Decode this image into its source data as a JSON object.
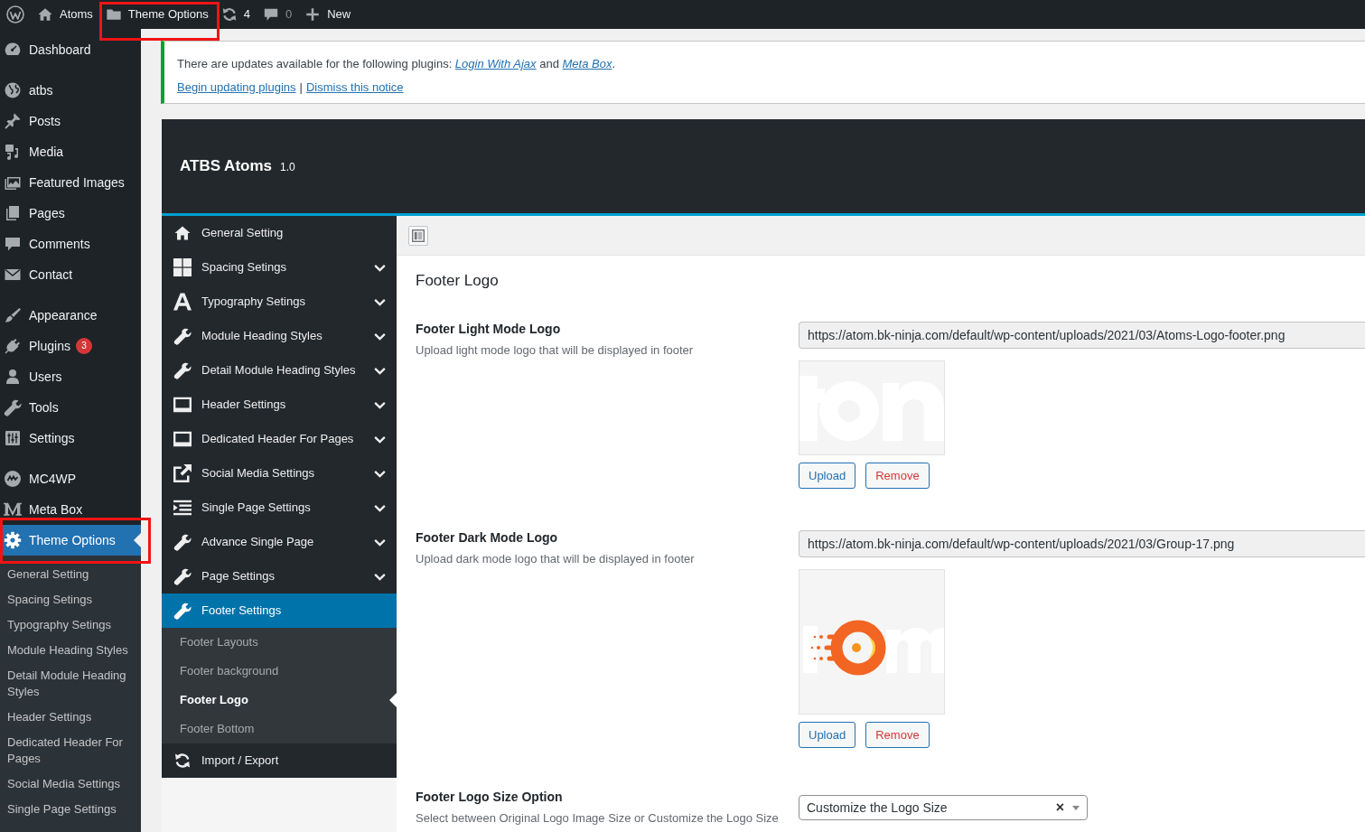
{
  "admin_bar": {
    "items": [
      {
        "label": "Atoms",
        "dimmed": false,
        "highlighted": false
      },
      {
        "label": "Theme Options",
        "dimmed": false,
        "highlighted": true
      },
      {
        "label": "4",
        "dimmed": false,
        "highlighted": false
      },
      {
        "label": "0",
        "dimmed": true,
        "highlighted": false
      },
      {
        "label": "New",
        "dimmed": false,
        "highlighted": false
      }
    ]
  },
  "sidebar": {
    "groups": [
      {
        "items": [
          {
            "label": "Dashboard",
            "selected": false,
            "highlighted": false
          }
        ]
      },
      {
        "items": [
          {
            "label": "atbs",
            "selected": false,
            "highlighted": false
          },
          {
            "label": "Posts",
            "selected": false,
            "highlighted": false
          },
          {
            "label": "Media",
            "selected": false,
            "highlighted": false
          },
          {
            "label": "Featured Images",
            "selected": false,
            "highlighted": false
          },
          {
            "label": "Pages",
            "selected": false,
            "highlighted": false
          },
          {
            "label": "Comments",
            "selected": false,
            "highlighted": false
          },
          {
            "label": "Contact",
            "selected": false,
            "highlighted": false
          }
        ]
      },
      {
        "items": [
          {
            "label": "Appearance",
            "selected": false,
            "highlighted": false
          },
          {
            "label": "Plugins",
            "badge": "3",
            "selected": false,
            "highlighted": false
          },
          {
            "label": "Users",
            "selected": false,
            "highlighted": false
          },
          {
            "label": "Tools",
            "selected": false,
            "highlighted": false
          },
          {
            "label": "Settings",
            "selected": false,
            "highlighted": false
          }
        ]
      },
      {
        "items": [
          {
            "label": "MC4WP",
            "selected": false,
            "highlighted": false
          },
          {
            "label": "Meta Box",
            "selected": false,
            "highlighted": false
          },
          {
            "label": "Theme Options",
            "selected": true,
            "highlighted": true,
            "children": [
              {
                "label": "General Setting",
                "selected": false
              },
              {
                "label": "Spacing Setings",
                "selected": false
              },
              {
                "label": "Typography Setings",
                "selected": false
              },
              {
                "label": "Module Heading Styles",
                "selected": false
              },
              {
                "label": "Detail Module Heading Styles",
                "selected": false
              },
              {
                "label": "Header Settings",
                "selected": false
              },
              {
                "label": "Dedicated Header For Pages",
                "selected": false
              },
              {
                "label": "Social Media Settings",
                "selected": false
              },
              {
                "label": "Single Page Settings",
                "selected": false
              }
            ]
          }
        ]
      }
    ]
  },
  "notice": {
    "message": [
      {
        "kind": "text",
        "text": "There are updates available for the following plugins: "
      },
      {
        "kind": "link",
        "text": "Login With Ajax"
      },
      {
        "kind": "text",
        "text": " and "
      },
      {
        "kind": "link",
        "text": "Meta Box"
      },
      {
        "kind": "text",
        "text": "."
      }
    ],
    "actions": [
      "Begin updating plugins",
      "Dismiss this notice"
    ],
    "separator": "|"
  },
  "panel": {
    "title": "ATBS Atoms",
    "version": "1.0",
    "menu": [
      {
        "label": "General Setting",
        "expandable": false,
        "selected": false
      },
      {
        "label": "Spacing Setings",
        "expandable": true,
        "selected": false
      },
      {
        "label": "Typography Setings",
        "expandable": true,
        "selected": false
      },
      {
        "label": "Module Heading Styles",
        "expandable": true,
        "selected": false
      },
      {
        "label": "Detail Module Heading Styles",
        "expandable": true,
        "selected": false
      },
      {
        "label": "Header Settings",
        "expandable": true,
        "selected": false
      },
      {
        "label": "Dedicated Header For Pages",
        "expandable": true,
        "selected": false
      },
      {
        "label": "Social Media Settings",
        "expandable": true,
        "selected": false
      },
      {
        "label": "Single Page Settings",
        "expandable": true,
        "selected": false
      },
      {
        "label": "Advance Single Page",
        "expandable": true,
        "selected": false
      },
      {
        "label": "Page Settings",
        "expandable": true,
        "selected": false
      },
      {
        "label": "Footer Settings",
        "expandable": false,
        "selected": true,
        "children": [
          {
            "label": "Footer Layouts",
            "selected": false
          },
          {
            "label": "Footer background",
            "selected": false
          },
          {
            "label": "Footer Logo",
            "selected": true
          },
          {
            "label": "Footer Bottom",
            "selected": false
          }
        ]
      },
      {
        "label": "Import / Export",
        "expandable": false,
        "selected": false
      }
    ],
    "section_title": "Footer Logo",
    "fields": [
      {
        "kind": "image",
        "title": "Footer Light Mode Logo",
        "description": "Upload light mode logo that will be displayed in footer",
        "value": "https://atom.bk-ninja.com/default/wp-content/uploads/2021/03/Atoms-Logo-footer.png",
        "buttons": [
          {
            "label": "Upload",
            "kind": "upload"
          },
          {
            "label": "Remove",
            "kind": "remove"
          }
        ]
      },
      {
        "kind": "image",
        "title": "Footer Dark Mode Logo",
        "description": "Upload dark mode logo that will be displayed in footer",
        "value": "https://atom.bk-ninja.com/default/wp-content/uploads/2021/03/Group-17.png",
        "buttons": [
          {
            "label": "Upload",
            "kind": "upload"
          },
          {
            "label": "Remove",
            "kind": "remove"
          }
        ]
      },
      {
        "kind": "select",
        "title": "Footer Logo Size Option",
        "description": "Select between Original Logo Image Size or Customize the Logo Size",
        "value": "Customize the Logo Size",
        "clear": "×"
      }
    ]
  }
}
